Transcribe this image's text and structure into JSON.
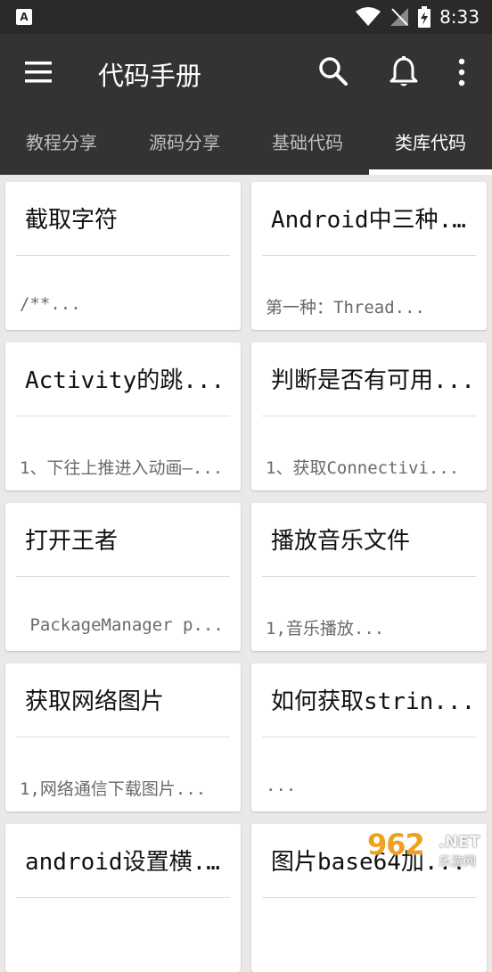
{
  "status_bar": {
    "app_badge": "A",
    "time": "8:33"
  },
  "app_bar": {
    "title": "代码手册",
    "icons": [
      "menu-icon",
      "search-icon",
      "bell-icon",
      "more-vertical-icon"
    ]
  },
  "tabs": [
    {
      "label": "教程分享"
    },
    {
      "label": "源码分享"
    },
    {
      "label": "基础代码"
    },
    {
      "label": "类库代码",
      "active": true
    }
  ],
  "cards": [
    {
      "title": "截取字符",
      "desc": "/**..."
    },
    {
      "title": "Android中三种...",
      "desc": "第一种：Thread..."
    },
    {
      "title": "Activity的跳...",
      "desc": "1、下往上推进入动画—..."
    },
    {
      "title": "判断是否有可用...",
      "desc": "1、获取Connectivi..."
    },
    {
      "title": "打开王者",
      "desc": " PackageManager p..."
    },
    {
      "title": "播放音乐文件",
      "desc": "1,音乐播放..."
    },
    {
      "title": "获取网络图片",
      "desc": "1,网络通信下载图片..."
    },
    {
      "title": "如何获取strin...",
      "desc": "..."
    },
    {
      "title": "android设置横...",
      "desc": ""
    },
    {
      "title": "图片base64加...",
      "desc": ""
    }
  ],
  "watermark": {
    "number": "962",
    "domain": ".NET",
    "sub": "乐游网"
  },
  "colors": {
    "app_bar": "#333333",
    "status_bar": "#2a2a2a",
    "background": "#e9e9e9",
    "card": "#ffffff",
    "tab_active": "#ffffff",
    "tab_inactive": "#bdbdbd"
  }
}
